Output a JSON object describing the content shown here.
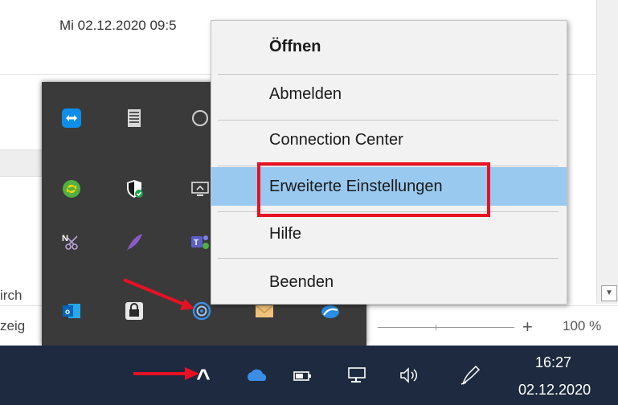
{
  "background": {
    "date_text": "Mi 02.12.2020 09:5",
    "side_text_1": "irch",
    "side_text_2": "zeig",
    "zoom": {
      "plus": "+",
      "label": "100 %"
    },
    "scroll_down": "▼"
  },
  "context_menu": {
    "items": [
      {
        "label": "Öffnen"
      },
      {
        "label": "Abmelden"
      },
      {
        "label": "Connection Center"
      },
      {
        "label": "Erweiterte Einstellungen"
      },
      {
        "label": "Hilfe"
      },
      {
        "label": "Beenden"
      }
    ],
    "default_item": "Öffnen",
    "highlighted_item": "Erweiterte Einstellungen",
    "highlight_color": "#99c9ef",
    "annotation_color": "#e81123"
  },
  "tray_icons": [
    "teamviewer-icon",
    "taskmgr-icon",
    "circle-icon",
    "sync-icon",
    "defender-shield-icon",
    "display-icon",
    "onenote-clipper-icon",
    "feather-icon",
    "teams-icon",
    "outlook-icon",
    "keepass-lock-icon",
    "citrix-receiver-icon",
    "mail-icon",
    "cloud-icon"
  ],
  "taskbar": {
    "clock_time": "16:27",
    "clock_date": "02.12.2020",
    "background": "#1d2a3f",
    "chevron": "^"
  }
}
